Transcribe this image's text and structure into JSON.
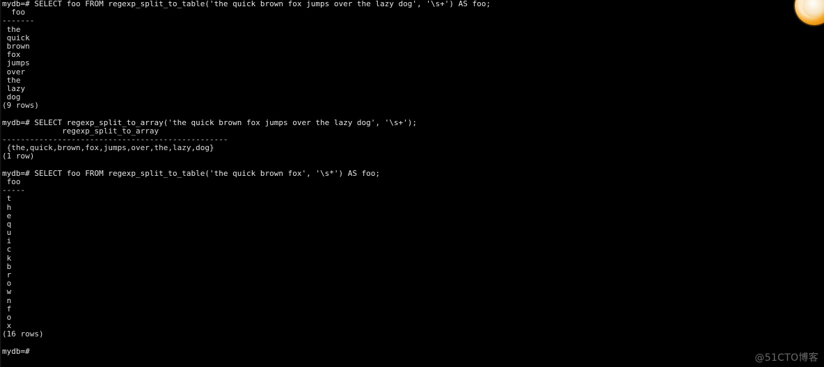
{
  "terminal": {
    "prompt": "mydb=#",
    "watermark": "@51CTO博客",
    "background_color": "#000000",
    "text_color": "#d8d8d8",
    "accent_color": "#f5a623",
    "watermark_color": "#6b6b6b",
    "lines": [
      {
        "type": "prompt",
        "text": "mydb=# SELECT foo FROM regexp_split_to_table('the quick brown fox jumps over the lazy dog', '\\s+') AS foo;"
      },
      {
        "type": "header",
        "text": "  foo"
      },
      {
        "type": "rule",
        "text": "-------"
      },
      {
        "type": "result",
        "text": " the"
      },
      {
        "type": "result",
        "text": " quick"
      },
      {
        "type": "result",
        "text": " brown"
      },
      {
        "type": "result",
        "text": " fox"
      },
      {
        "type": "result",
        "text": " jumps"
      },
      {
        "type": "result",
        "text": " over"
      },
      {
        "type": "result",
        "text": " the"
      },
      {
        "type": "result",
        "text": " lazy"
      },
      {
        "type": "result",
        "text": " dog"
      },
      {
        "type": "count",
        "text": "(9 rows)"
      },
      {
        "type": "blank",
        "text": " "
      },
      {
        "type": "prompt",
        "text": "mydb=# SELECT regexp_split_to_array('the quick brown fox jumps over the lazy dog', '\\s+');"
      },
      {
        "type": "header",
        "text": "             regexp_split_to_array"
      },
      {
        "type": "rule",
        "text": "-------------------------------------------------"
      },
      {
        "type": "result",
        "text": " {the,quick,brown,fox,jumps,over,the,lazy,dog}"
      },
      {
        "type": "count",
        "text": "(1 row)"
      },
      {
        "type": "blank",
        "text": " "
      },
      {
        "type": "prompt",
        "text": "mydb=# SELECT foo FROM regexp_split_to_table('the quick brown fox', '\\s*') AS foo;"
      },
      {
        "type": "header",
        "text": " foo"
      },
      {
        "type": "rule",
        "text": "-----"
      },
      {
        "type": "result",
        "text": " t"
      },
      {
        "type": "result",
        "text": " h"
      },
      {
        "type": "result",
        "text": " e"
      },
      {
        "type": "result",
        "text": " q"
      },
      {
        "type": "result",
        "text": " u"
      },
      {
        "type": "result",
        "text": " i"
      },
      {
        "type": "result",
        "text": " c"
      },
      {
        "type": "result",
        "text": " k"
      },
      {
        "type": "result",
        "text": " b"
      },
      {
        "type": "result",
        "text": " r"
      },
      {
        "type": "result",
        "text": " o"
      },
      {
        "type": "result",
        "text": " w"
      },
      {
        "type": "result",
        "text": " n"
      },
      {
        "type": "result",
        "text": " f"
      },
      {
        "type": "result",
        "text": " o"
      },
      {
        "type": "result",
        "text": " x"
      },
      {
        "type": "count",
        "text": "(16 rows)"
      },
      {
        "type": "blank",
        "text": " "
      },
      {
        "type": "prompt",
        "text": "mydb=#"
      }
    ]
  }
}
